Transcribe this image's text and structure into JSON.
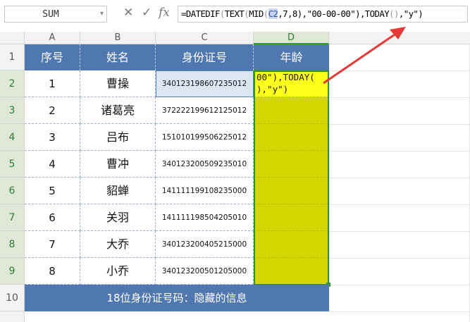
{
  "name_box": {
    "value": "SUM",
    "dropdown_glyph": "▾"
  },
  "formula_bar": {
    "cancel_icon": "✕",
    "enter_icon": "✓",
    "fx_label": "fx",
    "formula_parts": [
      "=DATEDIF",
      "(",
      "TEXT",
      "(",
      "MID",
      "(",
      "C2",
      ",7,8)",
      ",\"00-00-00\")",
      ",TODAY",
      "()",
      ",\"y\"",
      ")"
    ]
  },
  "columns": [
    "A",
    "B",
    "C",
    "D"
  ],
  "rows": [
    "1",
    "2",
    "3",
    "4",
    "5",
    "6",
    "7",
    "8",
    "9",
    "10"
  ],
  "table": {
    "headers": [
      "序号",
      "姓名",
      "身份证号",
      "年龄"
    ],
    "records": [
      {
        "no": "1",
        "name": "曹操",
        "id": "340123198607235012"
      },
      {
        "no": "2",
        "name": "诸葛亮",
        "id": "372222199612125012"
      },
      {
        "no": "3",
        "name": "吕布",
        "id": "151010199506225012"
      },
      {
        "no": "4",
        "name": "曹冲",
        "id": "340123200509235010"
      },
      {
        "no": "5",
        "name": "貂蝉",
        "id": "141111199108235000"
      },
      {
        "no": "6",
        "name": "关羽",
        "id": "141111198504205010"
      },
      {
        "no": "7",
        "name": "大乔",
        "id": "340123200405215000"
      },
      {
        "no": "8",
        "name": "小乔",
        "id": "340123200501205000"
      }
    ],
    "editing_text": "00\"),TODAY(\n),\"y\")",
    "footer": "18位身份证号码：隐藏的信息"
  },
  "colors": {
    "header_blue": "#5078b0",
    "age_fill": "#d4d600",
    "edit_fill": "#ffff1c",
    "selection_green": "#2f8f3a",
    "arrow_red": "#e53935"
  }
}
